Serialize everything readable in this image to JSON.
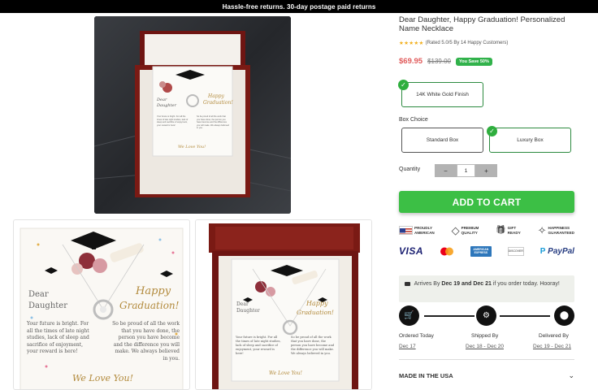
{
  "promo_bar": {
    "text": "Hassle-free returns. 30-day postage paid returns"
  },
  "product": {
    "title": "Dear Daughter, Happy Graduation! Personalized Name Necklace",
    "rating_stars": "★★★★★",
    "rating_text": "(Rated 5.0/5 By 14 Happy Customers)",
    "price_now": "$69.95",
    "price_was": "$139.00",
    "save_badge": "You Save 50%"
  },
  "card_text": {
    "dear": "Dear",
    "daughter": "Daughter",
    "happy": "Happy",
    "graduation": "Graduation!",
    "left_para": "Your future is bright. For all the times of late night studies, lack of sleep and sacrifice of enjoyment, your reward is here!",
    "right_para": "So be proud of all the work that you have done, the person you have become and the difference you will make. We always believed in you.",
    "sign": "We Love You!"
  },
  "options": {
    "finish_selected": "14K White Gold Finish",
    "box_choice_label": "Box Choice",
    "box_standard": "Standard Box",
    "box_luxury": "Luxury Box",
    "quantity_label": "Quantity",
    "minus": "−",
    "quantity_value": "1",
    "plus": "+"
  },
  "add_to_cart": "ADD TO CART",
  "badges": [
    {
      "icon": "us-flag-icon",
      "line1": "PROUDLY",
      "line2": "AMERICAN"
    },
    {
      "icon": "diamond-icon",
      "glyph": "◇",
      "line1": "PREMIUM",
      "line2": "QUALITY"
    },
    {
      "icon": "gift-icon",
      "glyph": "🎁",
      "line1": "GIFT",
      "line2": "READY"
    },
    {
      "icon": "happiness-icon",
      "glyph": "✧",
      "line1": "HAPPINESS",
      "line2": "GUARANTEED"
    }
  ],
  "payments": {
    "visa": "VISA",
    "amex": "AMERICAN EXPRESS",
    "discover": "DISCOVER",
    "paypal": "PayPal"
  },
  "delivery": {
    "arrives_prefix": "Arrives By",
    "date_range": "Dec 19 and Dec 21",
    "arrives_suffix": "if you order today. Hooray!",
    "steps": [
      {
        "label": "Ordered Today",
        "date": "Dec 17"
      },
      {
        "label": "Shipped By",
        "date": "Dec 18 - Dec 20"
      },
      {
        "label": "Delivered By",
        "date": "Dec 19 - Dec 21"
      }
    ]
  },
  "made_in": {
    "label": "MADE IN THE USA",
    "chevron": "⌄"
  },
  "colors": {
    "accent_green": "#3cbf45",
    "price_red": "#e05a5a",
    "box_mahogany": "#7a1a14"
  }
}
